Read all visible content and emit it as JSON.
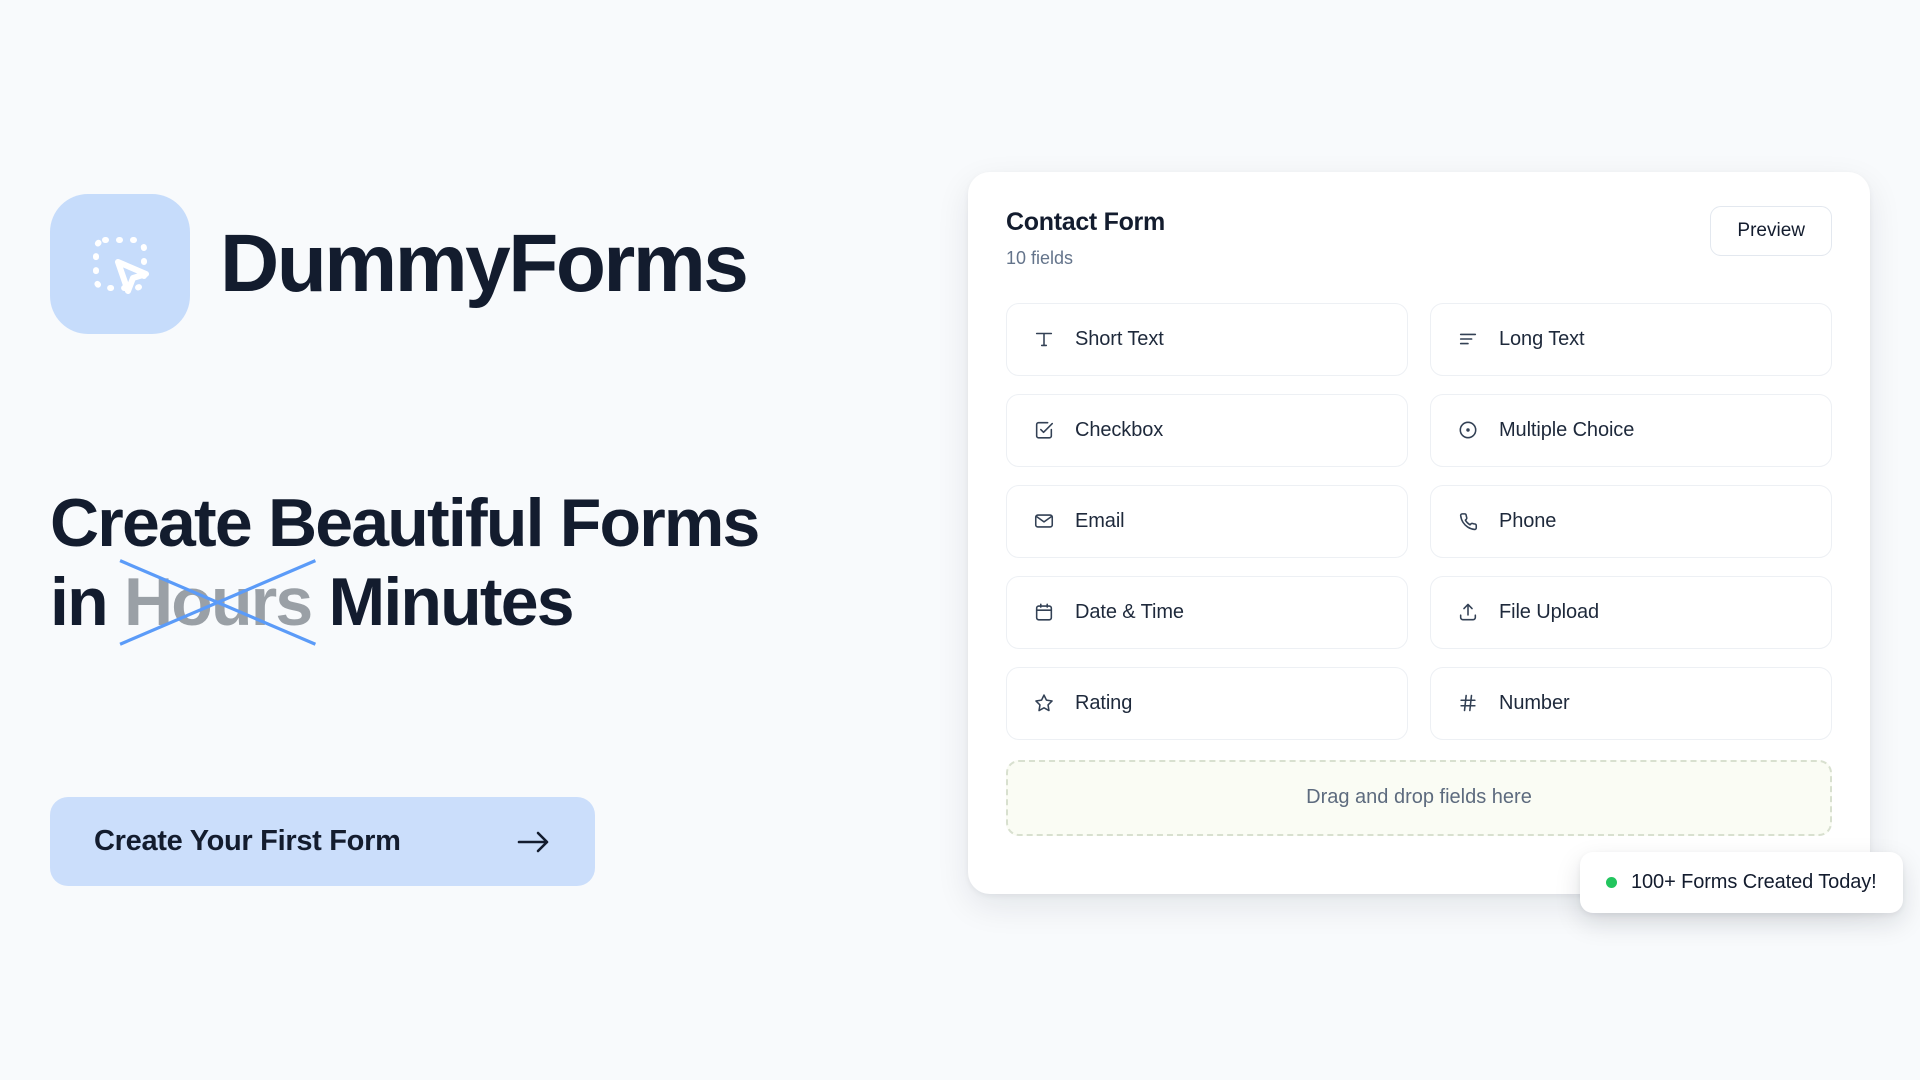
{
  "brand": {
    "name": "DummyForms",
    "logo_icon": "dashed-frame-cursor-icon",
    "logo_bg": "#c6dcfb"
  },
  "hero": {
    "headline_line1": "Create Beautiful Forms",
    "headline_prefix": "in",
    "headline_struck": "Hours",
    "headline_emphasis": "Minutes",
    "strike_color": "#5b9bf8",
    "struck_color": "#9aa0a6",
    "cta_label": "Create Your First Form",
    "cta_icon": "arrow-right-icon",
    "cta_bg": "#cbdefb"
  },
  "card": {
    "title": "Contact Form",
    "subtitle": "10 fields",
    "preview_label": "Preview",
    "fields": [
      {
        "label": "Short Text",
        "icon": "text-t-icon"
      },
      {
        "label": "Long Text",
        "icon": "text-lines-icon"
      },
      {
        "label": "Checkbox",
        "icon": "checkbox-check-icon"
      },
      {
        "label": "Multiple Choice",
        "icon": "radio-dot-icon"
      },
      {
        "label": "Email",
        "icon": "envelope-icon"
      },
      {
        "label": "Phone",
        "icon": "phone-icon"
      },
      {
        "label": "Date & Time",
        "icon": "calendar-icon"
      },
      {
        "label": "File Upload",
        "icon": "upload-icon"
      },
      {
        "label": "Rating",
        "icon": "star-icon"
      },
      {
        "label": "Number",
        "icon": "hash-icon"
      }
    ],
    "dropzone_label": "Drag and drop fields here"
  },
  "toast": {
    "label": "100+ Forms Created Today!",
    "dot_color": "#22c55e",
    "dot_icon": "status-dot-icon"
  }
}
